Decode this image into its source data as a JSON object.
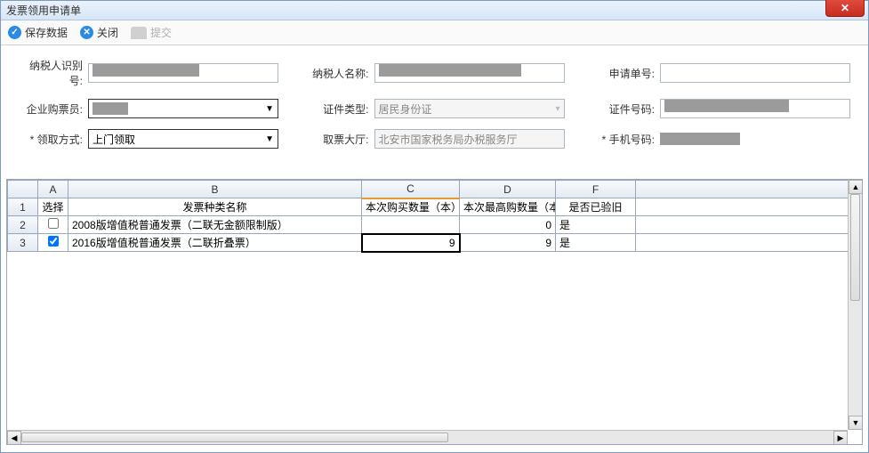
{
  "window": {
    "title": "发票领用申请单"
  },
  "toolbar": {
    "save": "保存数据",
    "close": "关闭",
    "submit": "提交"
  },
  "form": {
    "taxpayer_id_label": "纳税人识别号:",
    "taxpayer_name_label": "纳税人名称:",
    "request_no_label": "申请单号:",
    "request_no_value": "",
    "buyer_label": "企业购票员:",
    "buyer_value": "",
    "cert_type_label": "证件类型:",
    "cert_type_value": "居民身份证",
    "cert_no_label": "证件号码:",
    "pickup_label": "* 领取方式:",
    "pickup_value": "上门领取",
    "hall_label": "取票大厅:",
    "hall_value": "北安市国家税务局办税服务厅",
    "phone_label": "* 手机号码:"
  },
  "grid": {
    "cols": {
      "A": "A",
      "B": "B",
      "C": "C",
      "D": "D",
      "F": "F"
    },
    "headers": {
      "select": "选择",
      "name": "发票种类名称",
      "buy_qty": "本次购买数量（本）",
      "max_qty": "本次最高购数量（本）",
      "verified": "是否已验旧"
    },
    "rows": [
      {
        "idx": "2",
        "checked": false,
        "name": "2008版增值税普通发票（二联无金额限制版）",
        "buy_qty": "",
        "max_qty": "0",
        "verified": "是"
      },
      {
        "idx": "3",
        "checked": true,
        "name": "2016版增值税普通发票（二联折叠票）",
        "buy_qty": "9",
        "max_qty": "9",
        "verified": "是"
      }
    ]
  }
}
